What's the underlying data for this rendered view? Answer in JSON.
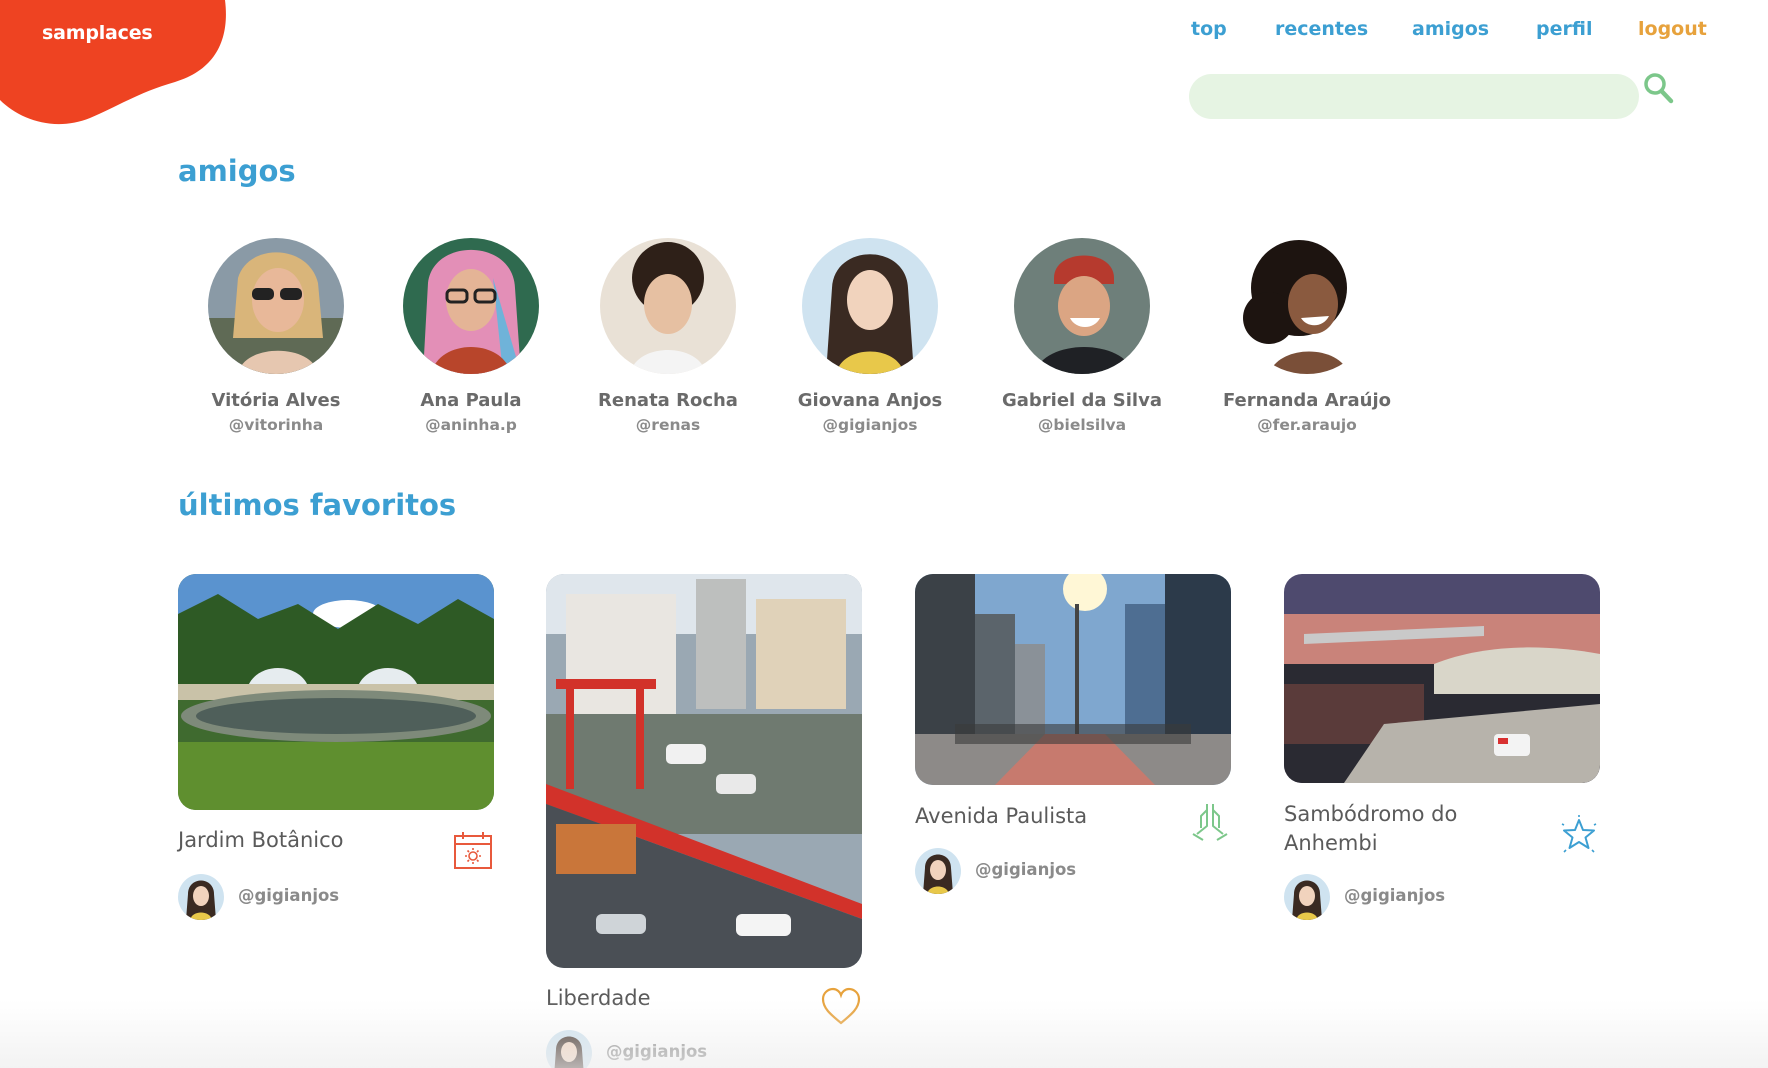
{
  "brand": {
    "name": "samplaces",
    "color": "#ee4322"
  },
  "nav": {
    "items": [
      "top",
      "recentes",
      "amigos",
      "perfil"
    ],
    "logout": "logout",
    "accent": "#3c9fd2",
    "logout_color": "#e7a23c"
  },
  "search": {
    "placeholder": "",
    "value": "",
    "icon": "search-icon",
    "color": "#7cc78a"
  },
  "friends": {
    "title": "amigos",
    "items": [
      {
        "name": "Vitória Alves",
        "handle": "@vitorinha"
      },
      {
        "name": "Ana Paula",
        "handle": "@aninha.p"
      },
      {
        "name": "Renata Rocha",
        "handle": "@renas"
      },
      {
        "name": "Giovana Anjos",
        "handle": "@gigianjos"
      },
      {
        "name": "Gabriel da Silva",
        "handle": "@bielsilva"
      },
      {
        "name": "Fernanda Araújo",
        "handle": "@fer.araujo"
      }
    ]
  },
  "favorites": {
    "title": "últimos favoritos",
    "items": [
      {
        "place": "Jardim Botânico",
        "user": "@gigianjos",
        "icon": "calendar-sun-icon",
        "icon_color": "#e8593c"
      },
      {
        "place": "Liberdade",
        "user": "@gigianjos",
        "icon": "heart-icon",
        "icon_color": "#e7a23c"
      },
      {
        "place": "Avenida Paulista",
        "user": "@gigianjos",
        "icon": "praying-hands-icon",
        "icon_color": "#7cc78a"
      },
      {
        "place": "Sambódromo do Anhembi",
        "user": "@gigianjos",
        "icon": "star-icon",
        "icon_color": "#3c9fd2"
      }
    ]
  }
}
